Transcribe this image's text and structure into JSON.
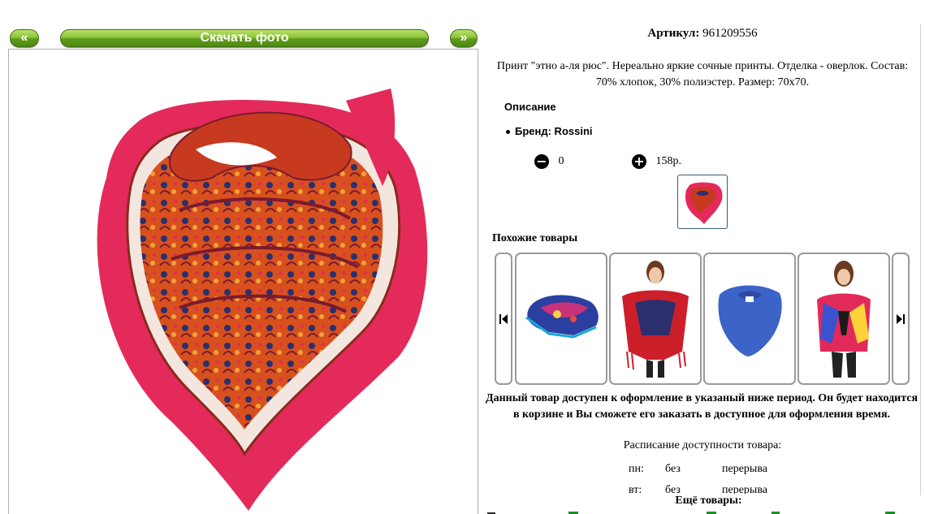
{
  "nav": {
    "prev_label": "«",
    "download_label": "Скачать фото",
    "next_label": "»"
  },
  "product": {
    "article_label": "Артикул:",
    "article_value": "961209556",
    "description": "Принт \"этно а-ля рюс\". Нереально яркие сочные принты. Отделка - оверлок. Состав: 70% хлопок, 30% полиэстер. Размер: 70х70.",
    "description_title": "Описание",
    "brand": "Бренд: Rossini",
    "quantity": "0",
    "price": "158р."
  },
  "similar": {
    "title": "Похожие товары",
    "items": [
      "scarf-blue-print",
      "woman-red-shawl",
      "scarf-blue",
      "woman-colorful-scarf"
    ]
  },
  "availability": {
    "notice": "Данный товар доступен к оформление в указаный ниже период. Он будет находится в корзине и Вы сможете его заказать в доступное для оформления время.",
    "schedule_title": "Расписание доступности товара:",
    "rows": [
      {
        "day": "пн:",
        "a": "без",
        "b": "перерыва"
      },
      {
        "day": "вт:",
        "a": "без",
        "b": "перерыва"
      }
    ]
  },
  "more_title": "Ещё товары:",
  "colors": {
    "button_green": "#6aa823",
    "scarf_pink": "#e42a5a",
    "scarf_orange": "#d4521c",
    "scarf_navy": "#2b2f6e"
  }
}
